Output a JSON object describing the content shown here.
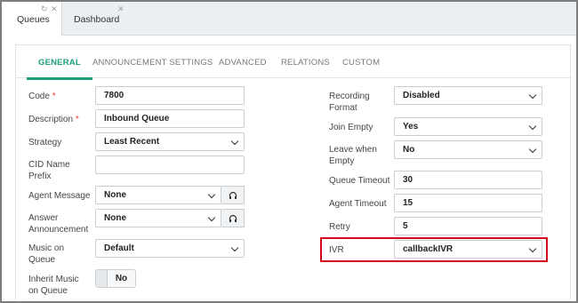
{
  "tabs": [
    {
      "label": "Queues",
      "active": true
    },
    {
      "label": "Dashboard",
      "active": false
    }
  ],
  "inner_tabs": [
    "GENERAL",
    "ANNOUNCEMENT SETTINGS",
    "ADVANCED",
    "RELATIONS",
    "CUSTOM"
  ],
  "left": {
    "code": {
      "label": "Code",
      "required": "*",
      "value": "7800"
    },
    "description": {
      "label": "Description",
      "required": "*",
      "value": "Inbound Queue"
    },
    "strategy": {
      "label": "Strategy",
      "value": "Least Recent"
    },
    "cid_name_prefix": {
      "label_line1": "CID Name",
      "label_line2": "Prefix",
      "value": ""
    },
    "agent_message": {
      "label": "Agent Message",
      "value": "None"
    },
    "answer_announcement": {
      "label_line1": "Answer",
      "label_line2": "Announcement",
      "value": "None"
    },
    "music_on_queue": {
      "label_line1": "Music on",
      "label_line2": "Queue",
      "value": "Default"
    },
    "inherit_music": {
      "label_line1": "Inherit Music",
      "label_line2": "on Queue",
      "value": "No"
    }
  },
  "right": {
    "recording_format": {
      "label_line1": "Recording",
      "label_line2": "Format",
      "value": "Disabled"
    },
    "join_empty": {
      "label": "Join Empty",
      "value": "Yes"
    },
    "leave_when_empty": {
      "label_line1": "Leave when",
      "label_line2": "Empty",
      "value": "No"
    },
    "queue_timeout": {
      "label": "Queue Timeout",
      "value": "30"
    },
    "agent_timeout": {
      "label": "Agent Timeout",
      "value": "15"
    },
    "retry": {
      "label": "Retry",
      "value": "5"
    },
    "ivr": {
      "label": "IVR",
      "value": "callbackIVR"
    }
  },
  "colors": {
    "accent": "#1a9e7a",
    "highlight": "#d0021b",
    "required": "#e53935"
  }
}
